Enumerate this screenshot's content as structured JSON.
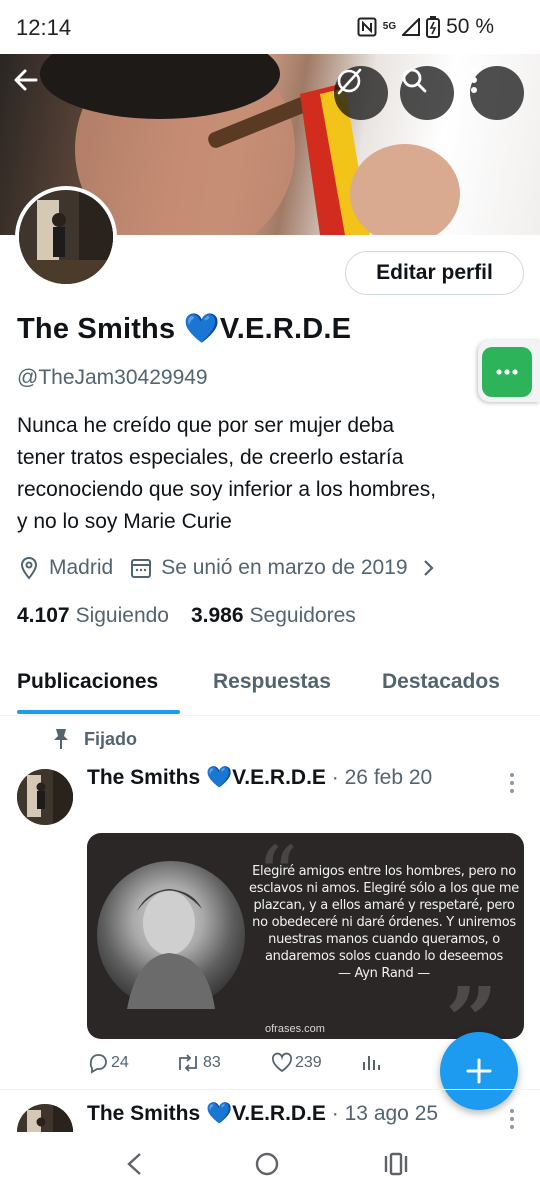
{
  "status_bar": {
    "time": "12:14",
    "network": "5G",
    "battery": "50 %",
    "icons": [
      "nfc-icon",
      "signal-icon",
      "battery-icon"
    ]
  },
  "header_buttons": {
    "back": "back-arrow-icon",
    "grok": "grok-icon",
    "search": "search-icon",
    "more": "more-vertical-icon"
  },
  "profile": {
    "edit_button": "Editar perfil",
    "name": "The Smiths",
    "name_emoji": "💙",
    "name_suffix": "V.E.R.D.E",
    "handle": "@TheJam30429949",
    "bio": "Nunca he creído que por ser mujer deba\ntener tratos especiales, de creerlo estaría\nreconociendo que soy inferior a los hombres,\ny no lo soy  Marie Curie",
    "location": "Madrid",
    "joined": "Se unió en marzo de 2019",
    "following_count": "4.107",
    "following_label": "Siguiendo",
    "followers_count": "3.986",
    "followers_label": "Seguidores"
  },
  "tabs": [
    {
      "label": "Publicaciones",
      "active": true
    },
    {
      "label": "Respuestas",
      "active": false
    },
    {
      "label": "Destacados",
      "active": false
    }
  ],
  "pinned_label": "Fijado",
  "posts": [
    {
      "author": "The Smiths 💙V.E.R.D.E",
      "separator": "·",
      "date": "26 feb 20",
      "media": {
        "quote": "Elegiré amigos entre los hombres, pero no esclavos ni amos. Elegiré sólo a los que me plazcan, y a ellos amaré y respetaré, pero no obedeceré ni daré órdenes. Y uniremos nuestras manos cuando queramos, o andaremos solos cuando lo deseemos",
        "attribution": "— Ayn Rand —",
        "watermark": "ofrases.com"
      },
      "replies": "24",
      "reposts": "83",
      "likes": "239"
    },
    {
      "author": "The Smiths 💙V.E.R.D.E",
      "separator": "·",
      "date": "13 ago 25"
    }
  ],
  "colors": {
    "accent": "#1d9bf0",
    "text_primary": "#0f1419",
    "text_secondary": "#536471",
    "chat_green": "#2db45a"
  }
}
